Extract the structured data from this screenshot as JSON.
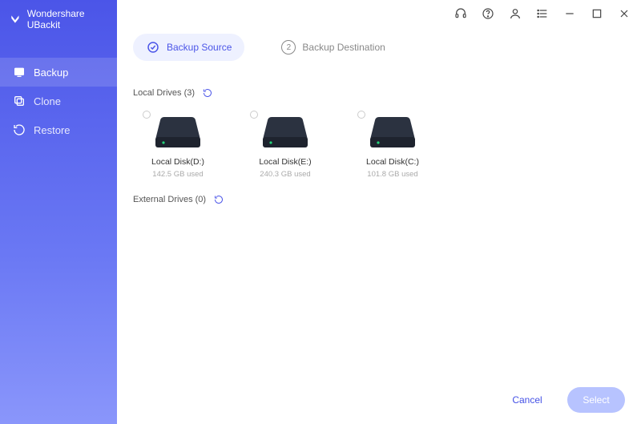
{
  "app": {
    "title": "Wondershare UBackit"
  },
  "sidebar": {
    "items": [
      {
        "label": "Backup",
        "icon": "backup-icon",
        "active": true
      },
      {
        "label": "Clone",
        "icon": "clone-icon",
        "active": false
      },
      {
        "label": "Restore",
        "icon": "restore-icon",
        "active": false
      }
    ]
  },
  "titlebar": {
    "icons": [
      "headset-icon",
      "help-icon",
      "user-icon",
      "menu-icon",
      "minimize-icon",
      "maximize-icon",
      "close-icon"
    ]
  },
  "steps": {
    "source": {
      "label": "Backup Source",
      "active": true
    },
    "destination": {
      "label": "Backup Destination",
      "badge": "2",
      "active": false
    }
  },
  "sections": {
    "local": {
      "title": "Local Drives (3)"
    },
    "external": {
      "title": "External Drives (0)"
    }
  },
  "drives": {
    "local": [
      {
        "name": "Local Disk(D:)",
        "used": "142.5 GB used"
      },
      {
        "name": "Local Disk(E:)",
        "used": "240.3 GB used"
      },
      {
        "name": "Local Disk(C:)",
        "used": "101.8 GB used"
      }
    ],
    "external": []
  },
  "footer": {
    "cancel": "Cancel",
    "select": "Select"
  },
  "colors": {
    "accent": "#4b55e8"
  }
}
